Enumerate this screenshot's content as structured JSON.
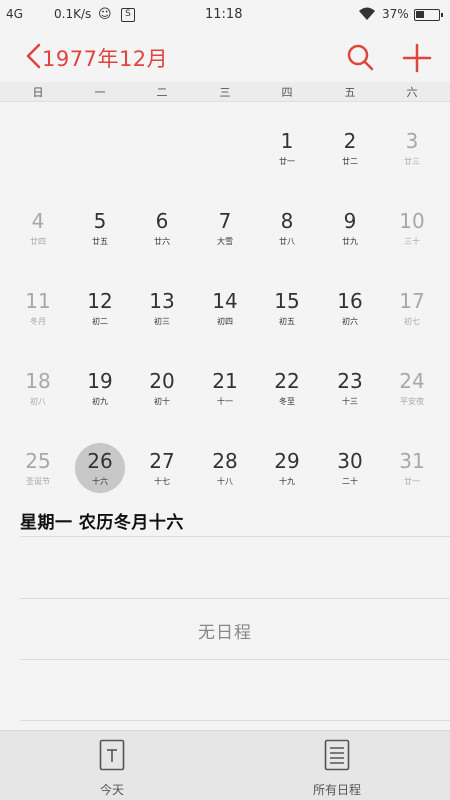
{
  "status_bar": {
    "network": "4G",
    "speed": "0.1K/s",
    "s_icon": "S",
    "time": "11:18",
    "battery_pct": "37%"
  },
  "header": {
    "title": "1977年12月",
    "accent_color": "#e0443e"
  },
  "weekdays": [
    "日",
    "一",
    "二",
    "三",
    "四",
    "五",
    "六"
  ],
  "calendar": {
    "rows": [
      [
        {
          "num": "",
          "sub": ""
        },
        {
          "num": "",
          "sub": ""
        },
        {
          "num": "",
          "sub": ""
        },
        {
          "num": "",
          "sub": ""
        },
        {
          "num": "1",
          "sub": "廿一"
        },
        {
          "num": "2",
          "sub": "廿二"
        },
        {
          "num": "3",
          "sub": "廿三"
        }
      ],
      [
        {
          "num": "4",
          "sub": "廿四"
        },
        {
          "num": "5",
          "sub": "廿五"
        },
        {
          "num": "6",
          "sub": "廿六"
        },
        {
          "num": "7",
          "sub": "大雪"
        },
        {
          "num": "8",
          "sub": "廿八"
        },
        {
          "num": "9",
          "sub": "廿九"
        },
        {
          "num": "10",
          "sub": "三十"
        }
      ],
      [
        {
          "num": "11",
          "sub": "冬月"
        },
        {
          "num": "12",
          "sub": "初二"
        },
        {
          "num": "13",
          "sub": "初三"
        },
        {
          "num": "14",
          "sub": "初四"
        },
        {
          "num": "15",
          "sub": "初五"
        },
        {
          "num": "16",
          "sub": "初六"
        },
        {
          "num": "17",
          "sub": "初七"
        }
      ],
      [
        {
          "num": "18",
          "sub": "初八"
        },
        {
          "num": "19",
          "sub": "初九"
        },
        {
          "num": "20",
          "sub": "初十"
        },
        {
          "num": "21",
          "sub": "十一"
        },
        {
          "num": "22",
          "sub": "冬至"
        },
        {
          "num": "23",
          "sub": "十三"
        },
        {
          "num": "24",
          "sub": "平安夜"
        }
      ],
      [
        {
          "num": "25",
          "sub": "圣诞节"
        },
        {
          "num": "26",
          "sub": "十六"
        },
        {
          "num": "27",
          "sub": "十七"
        },
        {
          "num": "28",
          "sub": "十八"
        },
        {
          "num": "29",
          "sub": "十九"
        },
        {
          "num": "30",
          "sub": "二十"
        },
        {
          "num": "31",
          "sub": "廿一"
        }
      ]
    ],
    "selected_day": "26"
  },
  "day_info": "星期一  农历冬月十六",
  "empty_text": "无日程",
  "bottom_tabs": {
    "today": "今天",
    "all": "所有日程"
  }
}
